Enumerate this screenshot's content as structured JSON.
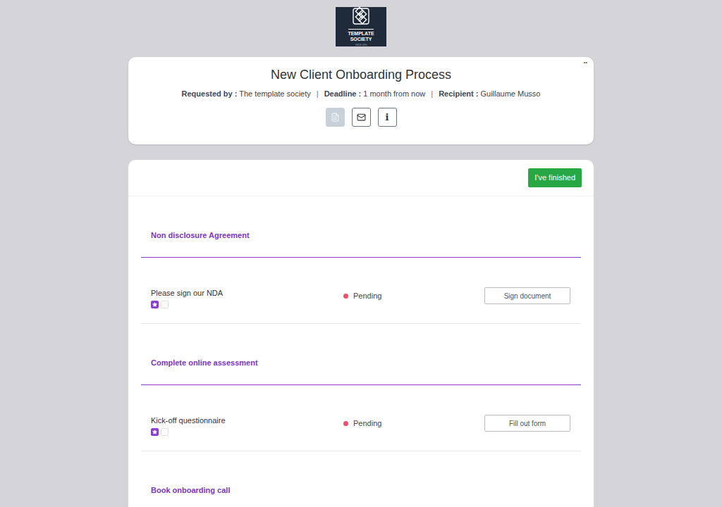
{
  "logo": {
    "line1": "TEMPLATE",
    "line2": "SOCIETY",
    "tagline": "SINCE 1990"
  },
  "header": {
    "title": "New Client Onboarding Process",
    "menu_glyph": "••",
    "separator": "|",
    "meta": [
      {
        "label": "Requested by :",
        "value": "The template society"
      },
      {
        "label": "Deadline :",
        "value": "1 month from now"
      },
      {
        "label": "Recipient :",
        "value": "Guillaume Musso"
      }
    ],
    "views": [
      {
        "kind": "document",
        "selected": true
      },
      {
        "kind": "mail",
        "selected": false
      },
      {
        "kind": "info",
        "glyph": "i",
        "selected": false
      }
    ]
  },
  "finish_button": "I've finished",
  "sections": [
    {
      "title": "Non disclosure Agreement",
      "tasks": [
        {
          "label": "Please sign our NDA",
          "starred": true,
          "status": "Pending",
          "status_color": "#ef4f6c",
          "action": "Sign document"
        }
      ]
    },
    {
      "title": "Complete online assessment",
      "tasks": [
        {
          "label": "Kick-off questionnaire",
          "starred": true,
          "status": "Pending",
          "status_color": "#ef4f6c",
          "action": "Fill out form"
        }
      ]
    },
    {
      "title": "Book onboarding call",
      "tasks": []
    }
  ]
}
